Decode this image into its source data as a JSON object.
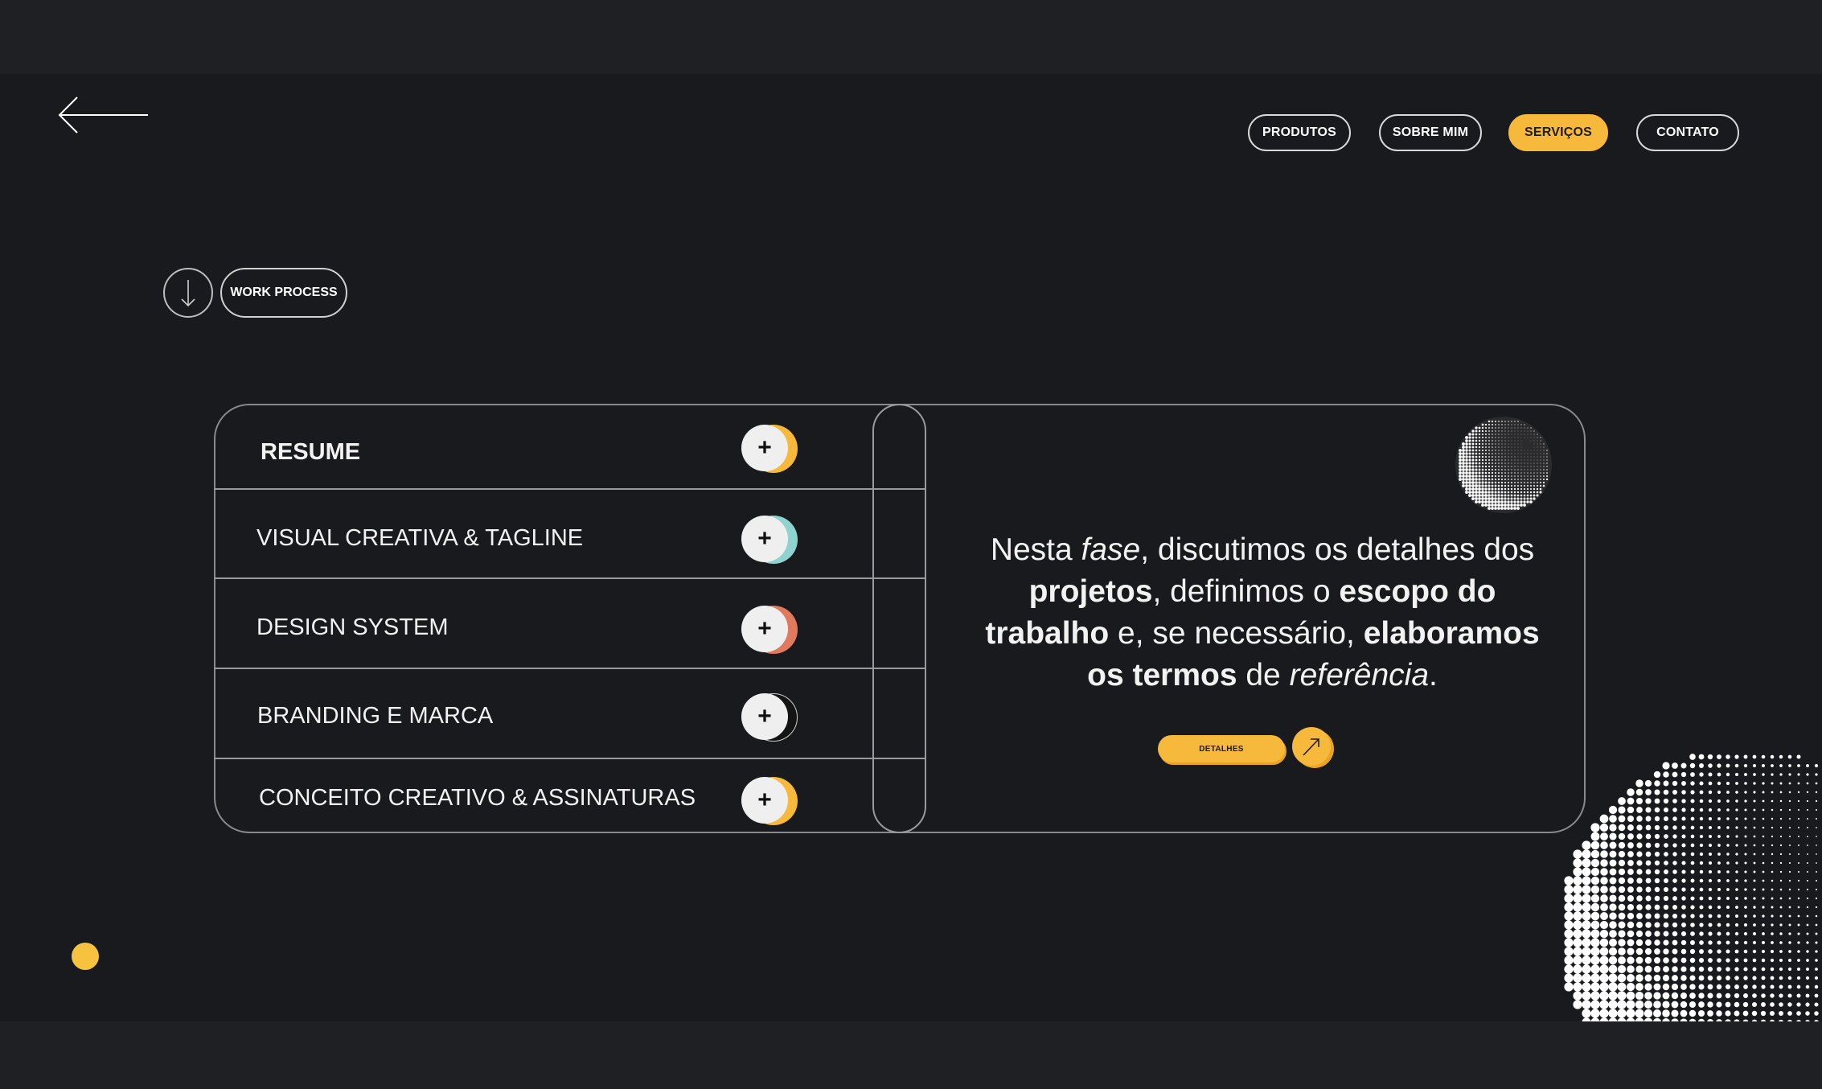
{
  "nav": {
    "items": [
      {
        "label": "PRODUTOS",
        "active": false
      },
      {
        "label": "SOBRE MIM",
        "active": false
      },
      {
        "label": "SERVIÇOS",
        "active": true
      },
      {
        "label": "CONTATO",
        "active": false
      }
    ]
  },
  "back_icon": "arrow-left-icon",
  "work_process": {
    "icon": "arrow-down-icon",
    "label": "WORK PROCESS"
  },
  "services": {
    "items": [
      {
        "label": "RESUME",
        "selected": true,
        "accent": "#f6b93b"
      },
      {
        "label": "VISUAL CREATIVA & TAGLINE",
        "selected": false,
        "accent": "#8fd3d0"
      },
      {
        "label": "DESIGN SYSTEM",
        "selected": false,
        "accent": "#e07a5f"
      },
      {
        "label": "BRANDING E MARCA",
        "selected": false,
        "accent": "#1b1b1b"
      },
      {
        "label": "CONCEITO CREATIVO & ASSINATURAS",
        "selected": false,
        "accent": "#f6b93b"
      }
    ],
    "plus_symbol": "+"
  },
  "description": {
    "parts": [
      {
        "t": "Nesta ",
        "s": "n"
      },
      {
        "t": "fase",
        "s": "i"
      },
      {
        "t": ", discutimos os detalhes dos ",
        "s": "n"
      },
      {
        "t": "projetos",
        "s": "b"
      },
      {
        "t": ", definimos o ",
        "s": "n"
      },
      {
        "t": "escopo do trabalho",
        "s": "b"
      },
      {
        "t": " e, se necessário, ",
        "s": "n"
      },
      {
        "t": "elaboramos os termos",
        "s": "b"
      },
      {
        "t": " de ",
        "s": "n"
      },
      {
        "t": "referência",
        "s": "i"
      },
      {
        "t": ".",
        "s": "n"
      }
    ]
  },
  "details_button": {
    "label": "DETALHES",
    "icon": "arrow-up-right-icon"
  },
  "colors": {
    "accent": "#f6b93b",
    "background": "#191a1d",
    "frame": "#1f2023",
    "text": "#f2f2f2"
  },
  "decorations": [
    "halftone-sphere-small",
    "halftone-sphere-large",
    "yellow-dot"
  ]
}
